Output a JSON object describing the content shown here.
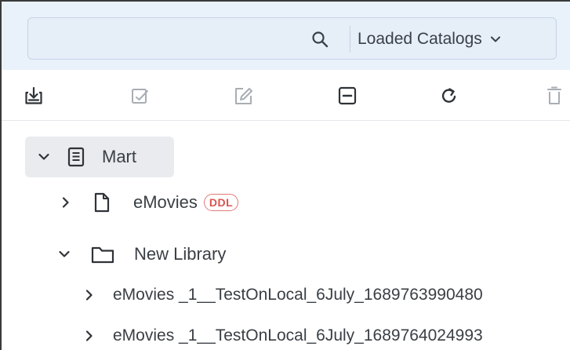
{
  "search": {
    "value": "",
    "placeholder": "",
    "catalog_label": "Loaded Catalogs"
  },
  "toolbar": [
    {
      "name": "import-button",
      "icon": "import-box-icon",
      "enabled": true
    },
    {
      "name": "edit-button",
      "icon": "edit-check-icon",
      "enabled": false
    },
    {
      "name": "rename-button",
      "icon": "rename-icon",
      "enabled": false
    },
    {
      "name": "collapse-all-button",
      "icon": "minus-box-icon",
      "enabled": true
    },
    {
      "name": "refresh-button",
      "icon": "refresh-icon",
      "enabled": true
    },
    {
      "name": "delete-button",
      "icon": "trash-icon",
      "enabled": false
    }
  ],
  "tree": {
    "mart_label": "Mart",
    "emovies_label": "eMovies",
    "emovies_badge": "DDL",
    "library_label": "New Library",
    "library_items": [
      "eMovies _1__TestOnLocal_6July_1689763990480",
      "eMovies _1__TestOnLocal_6July_1689764024993"
    ]
  },
  "colors": {
    "header_bg": "#e9f1fa",
    "selected_row_bg": "#e9ebee",
    "badge_red": "#d9534f",
    "icon_dark": "#2f3338",
    "icon_disabled": "#a9aeb4"
  }
}
